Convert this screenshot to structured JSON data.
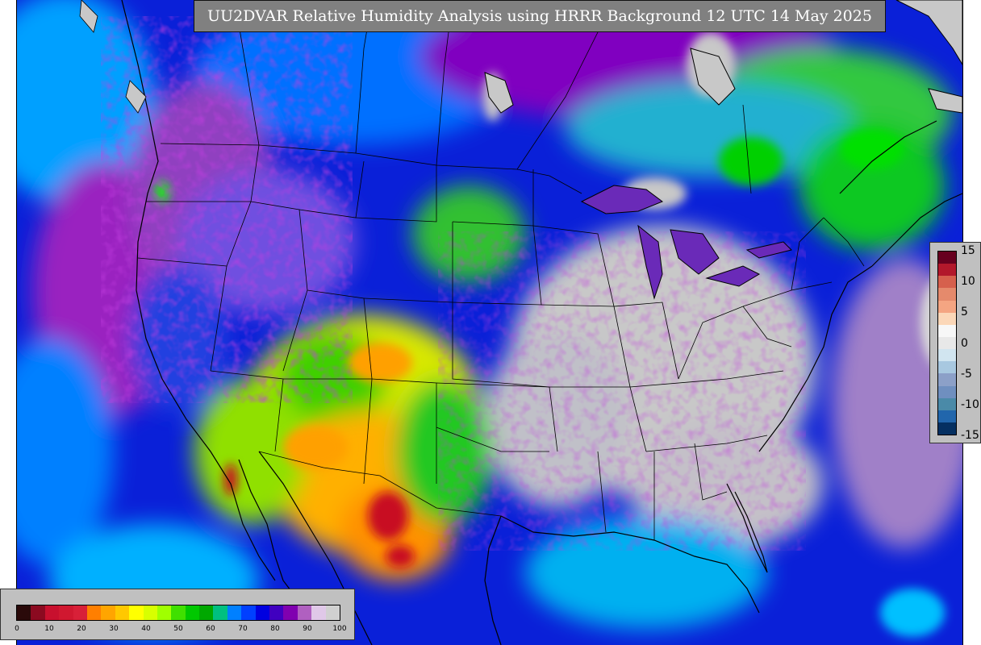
{
  "title": "UU2DVAR Relative Humidity Analysis using HRRR Background 12 UTC 14 May 2025",
  "rh_colorbar": {
    "ticks": [
      "0",
      "10",
      "20",
      "30",
      "40",
      "50",
      "60",
      "70",
      "80",
      "90",
      "100"
    ],
    "colors": [
      "#2a0a0a",
      "#8b0a20",
      "#c8102e",
      "#d01830",
      "#d82038",
      "#ff7f00",
      "#ffa500",
      "#ffc800",
      "#ffff00",
      "#d8ff00",
      "#a0ff00",
      "#40e000",
      "#00c800",
      "#00a800",
      "#00c080",
      "#0080ff",
      "#0040ff",
      "#0000e0",
      "#4000c0",
      "#8000b0",
      "#b060c0",
      "#e0c8e8",
      "#d0d0d0"
    ]
  },
  "diff_colorbar": {
    "ticks": [
      "15",
      "10",
      "5",
      "0",
      "-5",
      "-10",
      "-15"
    ],
    "colors": [
      "#67001f",
      "#b2182b",
      "#d6604d",
      "#e58a6c",
      "#f4a582",
      "#fbd7b8",
      "#f7f7f7",
      "#e8e8e8",
      "#d1e5f0",
      "#a8c8e0",
      "#8ca0c8",
      "#6f8fbf",
      "#4a8aa8",
      "#2166ac",
      "#053061"
    ]
  },
  "map_colors": {
    "ocean": "#0a20d8",
    "land_dry_high": "#c8c8c8",
    "purple_moist": "#7a10b0",
    "green_mid": "#20c820",
    "yellow_dry": "#f0f000",
    "orange_dry": "#ffa000",
    "red_very_dry": "#c81020"
  }
}
